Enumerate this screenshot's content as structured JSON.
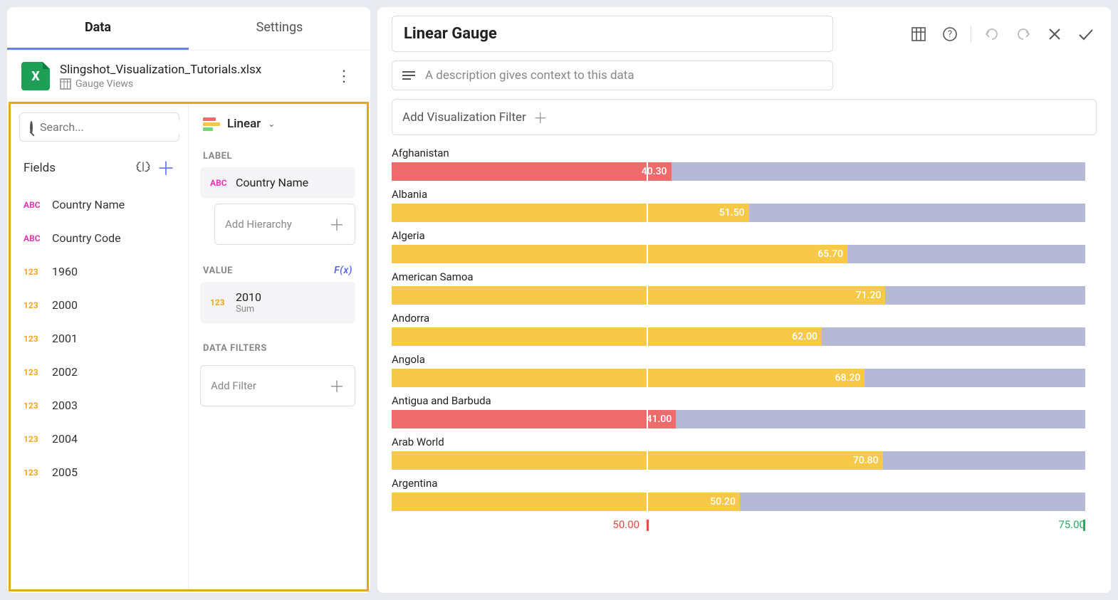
{
  "tabs": {
    "data": "Data",
    "settings": "Settings"
  },
  "datasource": {
    "filename": "Slingshot_Visualization_Tutorials.xlsx",
    "sheet": "Gauge Views"
  },
  "search": {
    "placeholder": "Search..."
  },
  "fields_header": "Fields",
  "fields": [
    {
      "type": "abc",
      "name": "Country Name"
    },
    {
      "type": "abc",
      "name": "Country Code"
    },
    {
      "type": "num",
      "name": "1960"
    },
    {
      "type": "num",
      "name": "2000"
    },
    {
      "type": "num",
      "name": "2001"
    },
    {
      "type": "num",
      "name": "2002"
    },
    {
      "type": "num",
      "name": "2003"
    },
    {
      "type": "num",
      "name": "2004"
    },
    {
      "type": "num",
      "name": "2005"
    }
  ],
  "viz": {
    "name": "Linear"
  },
  "sections": {
    "label": "LABEL",
    "value": "VALUE",
    "data_filters": "DATA FILTERS",
    "fx": "F(x)"
  },
  "label_pill": {
    "type": "abc",
    "name": "Country Name"
  },
  "value_pill": {
    "type": "num",
    "name": "2010",
    "agg": "Sum"
  },
  "placeholders": {
    "add_hierarchy": "Add Hierarchy",
    "add_filter": "Add Filter",
    "add_viz_filter": "Add Visualization Filter",
    "description": "A description gives context to this data"
  },
  "title": "Linear Gauge",
  "axis": {
    "min_marker": "50.00",
    "max_marker": "75.00"
  },
  "colors": {
    "red": "#ee6b6b",
    "yellow": "#f7c948",
    "track": "#b6b9d6"
  },
  "chart_data": {
    "type": "bar",
    "title": "Linear Gauge",
    "xlabel": "",
    "ylabel": "",
    "ylim": [
      0,
      100
    ],
    "thresholds": {
      "low": 50.0,
      "high": 75.0
    },
    "marker_at": 36.8,
    "categories": [
      "Afghanistan",
      "Albania",
      "Algeria",
      "American Samoa",
      "Andorra",
      "Angola",
      "Antigua and Barbuda",
      "Arab World",
      "Argentina"
    ],
    "values": [
      40.3,
      51.5,
      65.7,
      71.2,
      62.0,
      68.2,
      41.0,
      70.8,
      50.2
    ],
    "value_labels": [
      "40.30",
      "51.50",
      "65.70",
      "71.20",
      "62.00",
      "68.20",
      "41.00",
      "70.80",
      "50.20"
    ]
  }
}
